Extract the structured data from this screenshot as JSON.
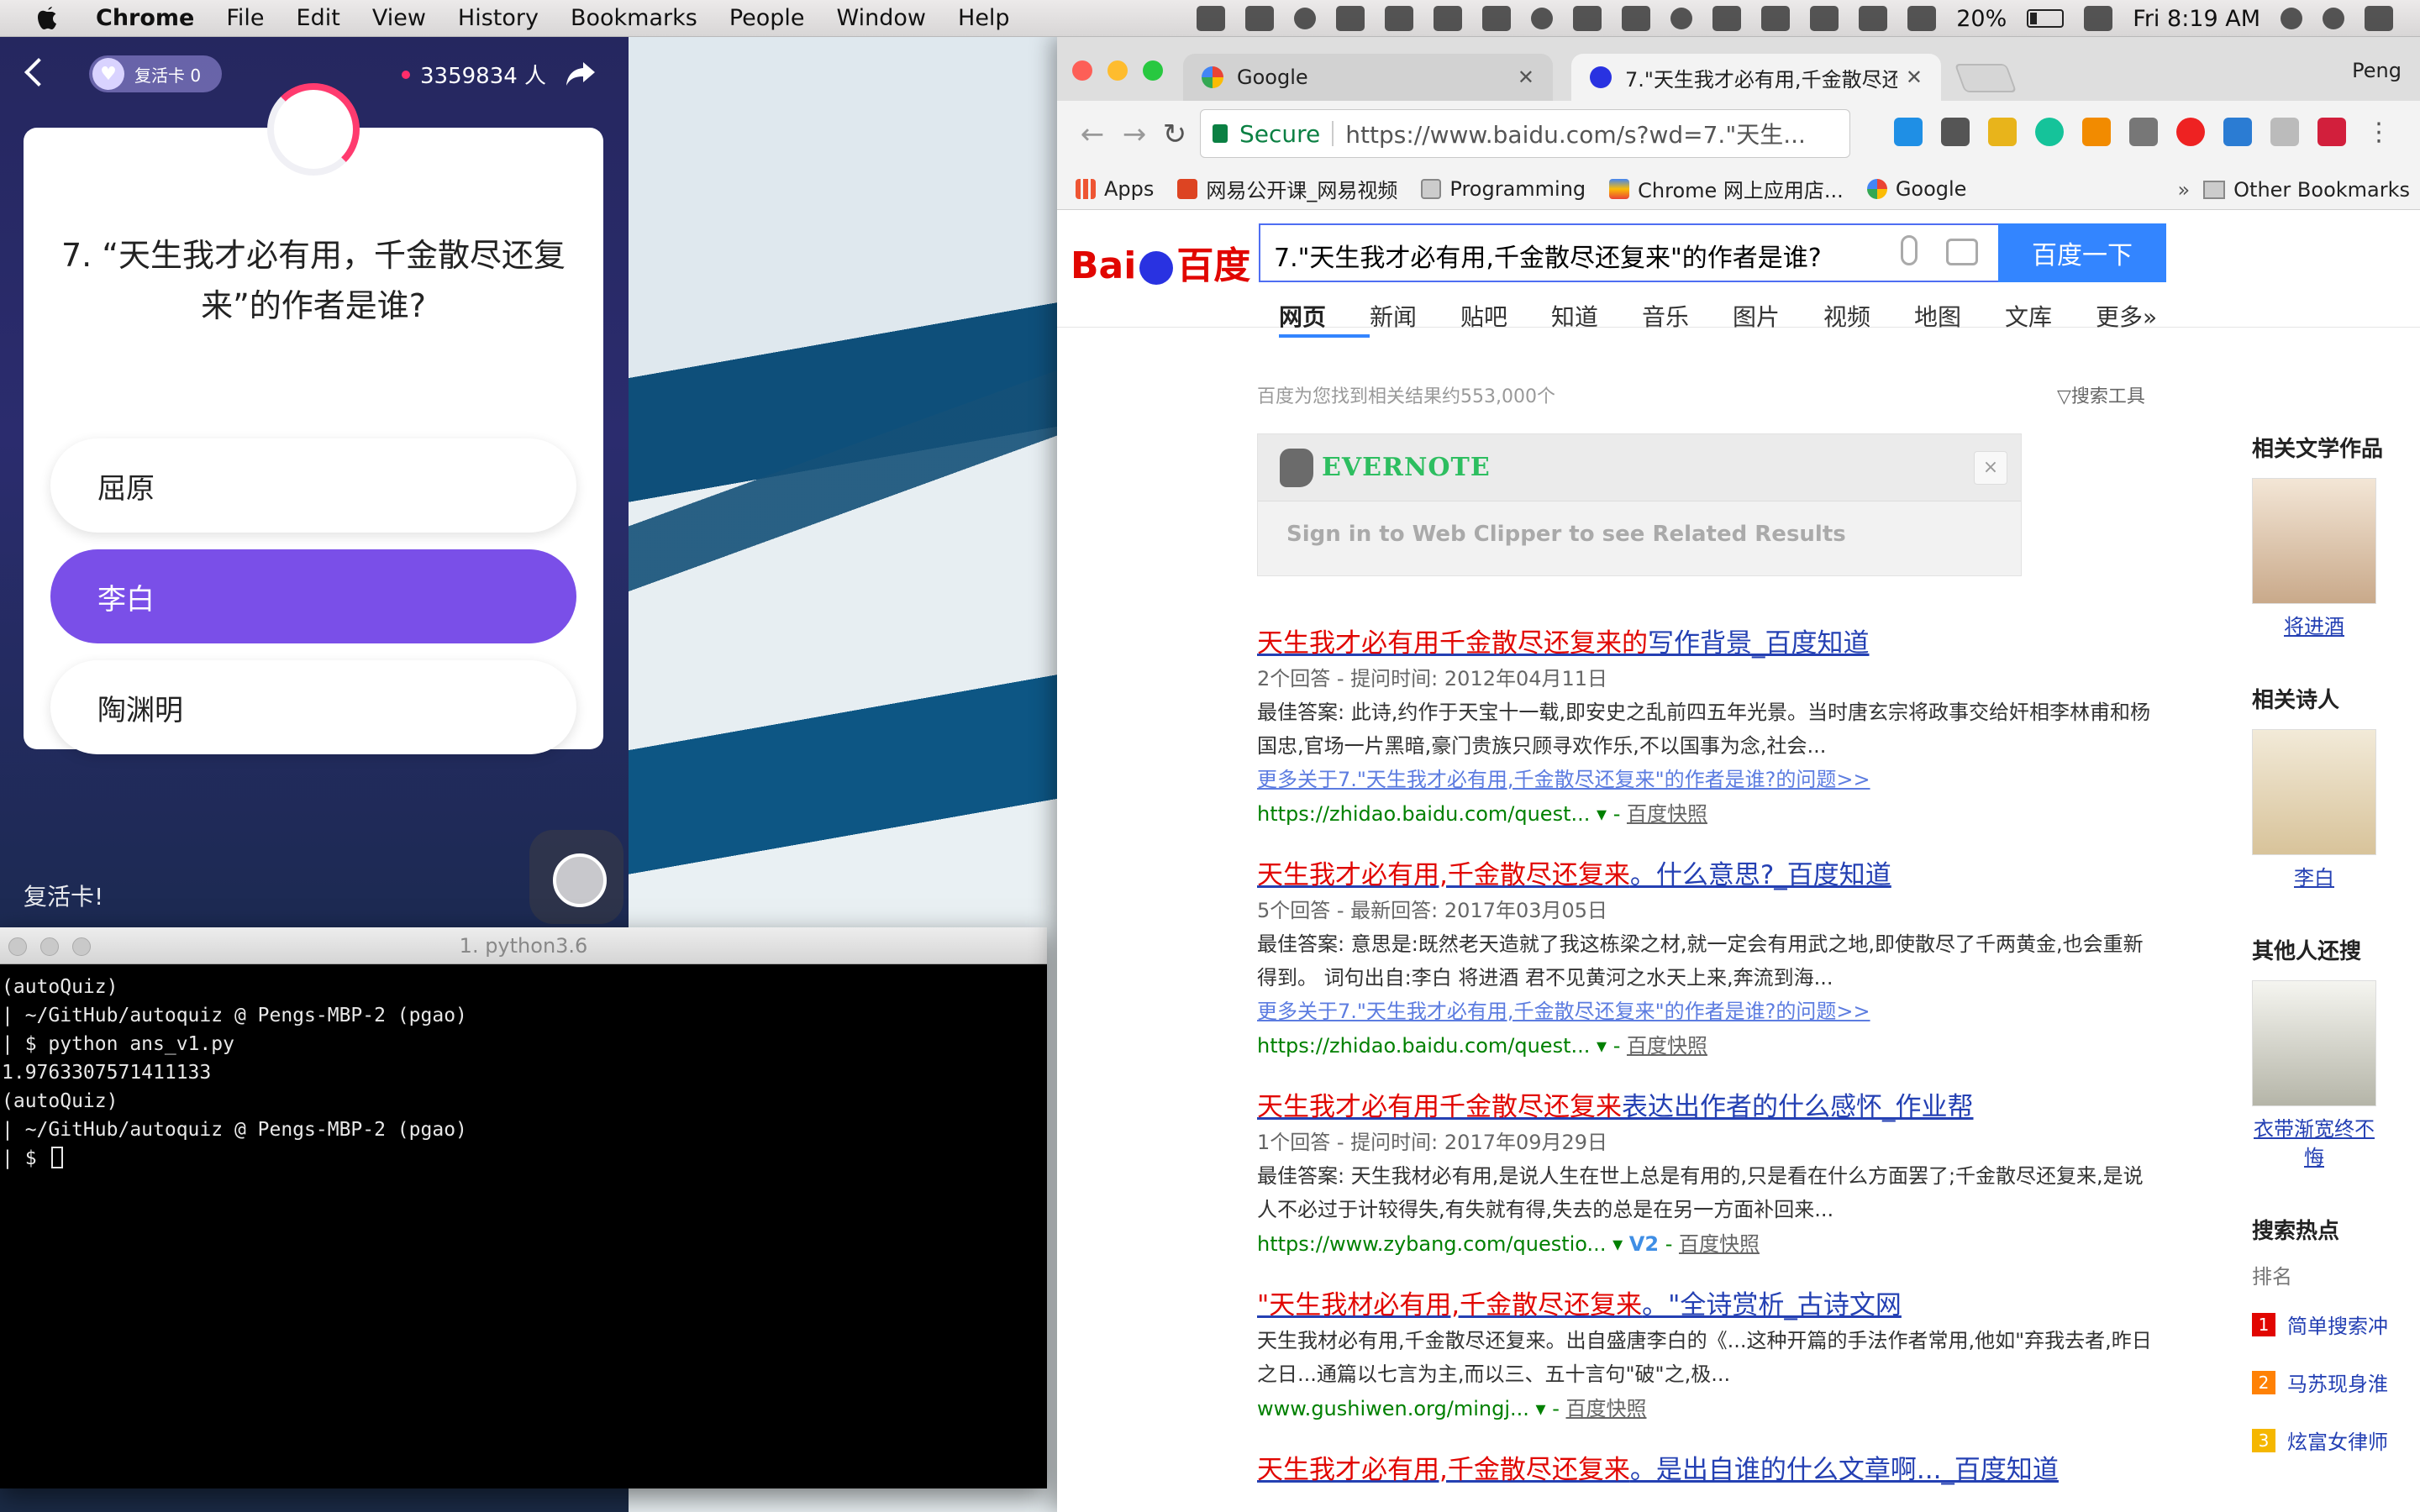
{
  "menubar": {
    "app_name": "Chrome",
    "menus": [
      "File",
      "Edit",
      "View",
      "History",
      "Bookmarks",
      "People",
      "Window",
      "Help"
    ],
    "battery_percent": "20%",
    "clock": "Fri 8:19 AM"
  },
  "quiz": {
    "revive_label": "复活卡 0",
    "viewer_count": "3359834 人",
    "question": "7. “天生我才必有用，千金散尽还复来”的作者是谁?",
    "options": [
      "屈原",
      "李白",
      "陶渊明"
    ],
    "selected_option": "李白",
    "toast": "复活卡!"
  },
  "terminal": {
    "title": "1. python3.6",
    "lines": [
      "(autoQuiz)",
      "| ~/GitHub/autoquiz @ Pengs-MBP-2 (pgao)",
      "| $ python ans_v1.py",
      "1.9763307571411133",
      "(autoQuiz)",
      "| ~/GitHub/autoquiz @ Pengs-MBP-2 (pgao)",
      "| $ "
    ]
  },
  "chrome": {
    "profile": "Peng",
    "tabs": [
      {
        "title": "Google"
      },
      {
        "title": "7.\"天生我才必有用,千金散尽还复"
      }
    ],
    "secure_label": "Secure",
    "url": "https://www.baidu.com/s?wd=7.\"天生...",
    "bookmarks": [
      "Apps",
      "网易公开课_网易视频",
      "Programming",
      "Chrome 网上应用店...",
      "Google"
    ],
    "other_bookmarks": "Other Bookmarks"
  },
  "baidu": {
    "logo_left": "Bai",
    "logo_mid": "du",
    "logo_right": "百度",
    "query": "7.\"天生我才必有用,千金散尽还复来\"的作者是谁?",
    "search_button": "百度一下",
    "tabs": [
      "网页",
      "新闻",
      "贴吧",
      "知道",
      "音乐",
      "图片",
      "视频",
      "地图",
      "文库",
      "更多»"
    ],
    "result_count": "百度为您找到相关结果约553,000个",
    "tools": "搜索工具",
    "evernote_brand": "EVERNOTE",
    "evernote_close": "×",
    "evernote_message": "Sign in to Web Clipper to see Related Results",
    "results": [
      {
        "title_hl": "天生我才必有用千金散尽还复来的",
        "title_rest": "写作背景_百度知道",
        "meta": "2个回答 - 提问时间: 2012年04月11日",
        "abstract": "最佳答案: 此诗,约作于天宝十一载,即安史之乱前四五年光景。当时唐玄宗将政事交给奸相李林甫和杨国忠,官场一片黑暗,豪门贵族只顾寻欢作乐,不以国事为念,社会...",
        "more": "更多关于7.\"天生我才必有用,千金散尽还复来\"的作者是谁?的问题>>",
        "url": "https://zhidao.baidu.com/quest...",
        "snapshot": "百度快照"
      },
      {
        "title_hl": "天生我才必有用,千金散尽还复来",
        "title_rest": "。什么意思?_百度知道",
        "meta": "5个回答 - 最新回答: 2017年03月05日",
        "abstract": "最佳答案: 意思是:既然老天造就了我这栋梁之材,就一定会有用武之地,即使散尽了千两黄金,也会重新得到。 词句出自:李白 将进酒 君不见黄河之水天上来,奔流到海...",
        "more": "更多关于7.\"天生我才必有用,千金散尽还复来\"的作者是谁?的问题>>",
        "url": "https://zhidao.baidu.com/quest...",
        "snapshot": "百度快照"
      },
      {
        "title_hl": "天生我才必有用千金散尽还复来",
        "title_rest": "表达出作者的什么感怀_作业帮",
        "meta": "1个回答 - 提问时间: 2017年09月29日",
        "abstract": "最佳答案: 天生我材必有用,是说人生在世上总是有用的,只是看在什么方面罢了;千金散尽还复来,是说人不必过于计较得失,有失就有得,失去的总是在另一方面补回来...",
        "url": "https://www.zybang.com/questio...",
        "badge": "V2",
        "snapshot": "百度快照"
      },
      {
        "title_hl": "\"天生我材必有用,千金散尽还复来",
        "title_rest": "。\"全诗赏析_古诗文网",
        "abstract": "天生我材必有用,千金散尽还复来。出自盛唐李白的《...这种开篇的手法作者常用,他如\"弃我去者,昨日之日...通篇以七言为主,而以三、五十言句\"破\"之,极...",
        "url": "www.gushiwen.org/mingj...",
        "snapshot": "百度快照"
      },
      {
        "title_hl": "天生我才必有用,千金散尽还复来",
        "title_rest": "。是出自谁的什么文章啊..._百度知道"
      }
    ],
    "sidebar": {
      "works_title": "相关文学作品",
      "works_link": "将进酒",
      "poets_title": "相关诗人",
      "poet_link": "李白",
      "others_title": "其他人还搜",
      "others_link": "衣带渐宽终不悔",
      "hot_title": "搜索热点",
      "hot_head": "排名",
      "hot_items": [
        {
          "rank": "1",
          "text": "简单搜索冲",
          "color": "#e10601"
        },
        {
          "rank": "2",
          "text": "马苏现身淮",
          "color": "#ff8105"
        },
        {
          "rank": "3",
          "text": "炫富女律师",
          "color": "#f5b700"
        }
      ]
    }
  }
}
